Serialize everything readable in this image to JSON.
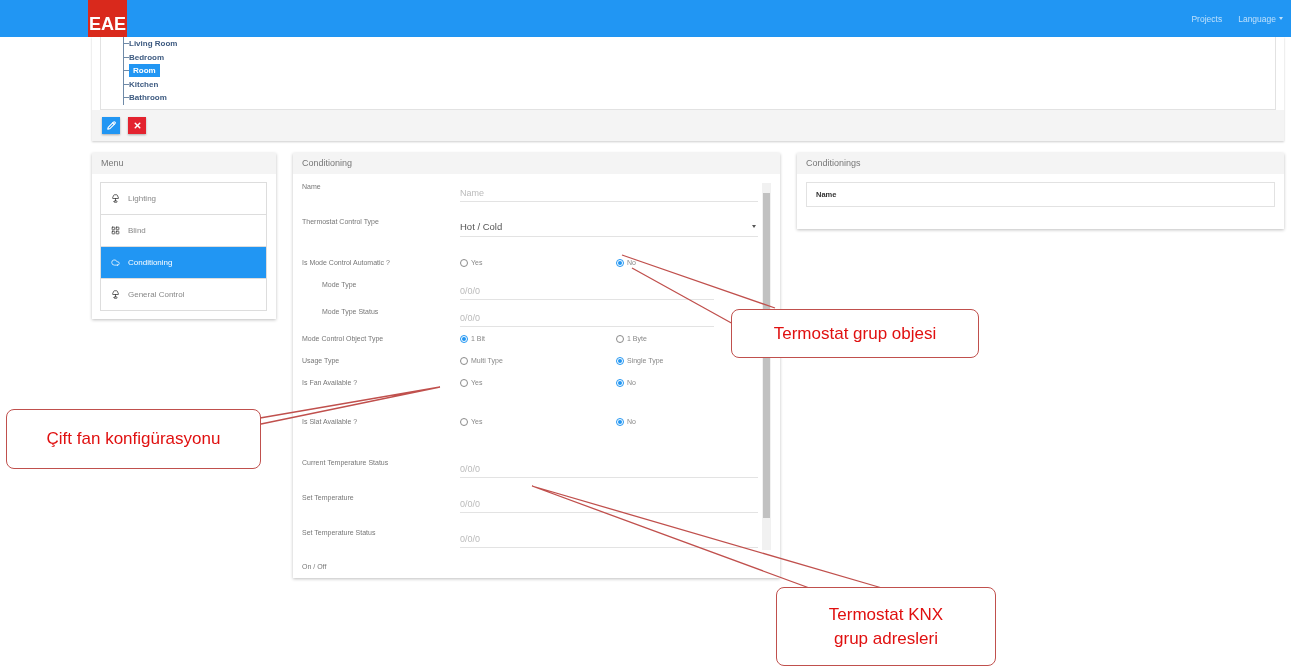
{
  "navbar": {
    "logo": "EAE",
    "links": [
      {
        "label": "Projects",
        "dropdown": false
      },
      {
        "label": "Language",
        "dropdown": true
      }
    ]
  },
  "tree": {
    "items": [
      {
        "label": "Living Room",
        "selected": false
      },
      {
        "label": "Bedroom",
        "selected": false
      },
      {
        "label": "Room",
        "selected": true
      },
      {
        "label": "Kitchen",
        "selected": false
      },
      {
        "label": "Bathroom",
        "selected": false
      }
    ]
  },
  "actions": [
    {
      "kind": "edit"
    },
    {
      "kind": "delete"
    }
  ],
  "menu": {
    "title": "Menu",
    "items": [
      {
        "label": "Lighting",
        "selected": false
      },
      {
        "label": "Blind",
        "selected": false
      },
      {
        "label": "Conditioning",
        "selected": true
      },
      {
        "label": "General Control",
        "selected": false
      }
    ]
  },
  "form": {
    "title": "Conditioning",
    "rows": [
      {
        "kind": "text",
        "label": "Name",
        "placeholder": "Name",
        "indented": false
      },
      {
        "kind": "select",
        "label": "Thermostat Control Type",
        "value": "Hot / Cold"
      },
      {
        "kind": "radio",
        "label": "Is Mode Control Automatic ?",
        "options": [
          {
            "label": "Yes",
            "selected": false
          },
          {
            "label": "No",
            "selected": true
          }
        ]
      },
      {
        "kind": "text",
        "label": "Mode Type",
        "placeholder": "0/0/0",
        "indented": true
      },
      {
        "kind": "text",
        "label": "Mode Type Status",
        "placeholder": "0/0/0",
        "indented": true
      },
      {
        "kind": "radio",
        "label": "Mode Control Object Type",
        "options": [
          {
            "label": "1 Bit",
            "selected": true
          },
          {
            "label": "1 Byte",
            "selected": false
          }
        ]
      },
      {
        "kind": "radio",
        "label": "Usage Type",
        "options": [
          {
            "label": "Multi Type",
            "selected": false
          },
          {
            "label": "Single Type",
            "selected": true
          }
        ]
      },
      {
        "kind": "radio",
        "label": "Is Fan Available ?",
        "options": [
          {
            "label": "Yes",
            "selected": false
          },
          {
            "label": "No",
            "selected": true
          }
        ]
      },
      {
        "kind": "radio",
        "label": "Is Slat Available ?",
        "options": [
          {
            "label": "Yes",
            "selected": false
          },
          {
            "label": "No",
            "selected": true
          }
        ]
      },
      {
        "kind": "text",
        "label": "Current Temperature Status",
        "placeholder": "0/0/0",
        "indented": false
      },
      {
        "kind": "text",
        "label": "Set Temperature",
        "placeholder": "0/0/0",
        "indented": false
      },
      {
        "kind": "text",
        "label": "Set Temperature Status",
        "placeholder": "0/0/0",
        "indented": false
      },
      {
        "kind": "label",
        "label": "On / Off"
      }
    ]
  },
  "conditionings": {
    "title": "Conditionings",
    "columns": [
      "Name"
    ]
  },
  "callouts": [
    {
      "text": "Termostat grup objesi"
    },
    {
      "text": "Çift fan konfigürasyonu"
    },
    {
      "text": "Termostat KNX grup adresleri"
    }
  ]
}
